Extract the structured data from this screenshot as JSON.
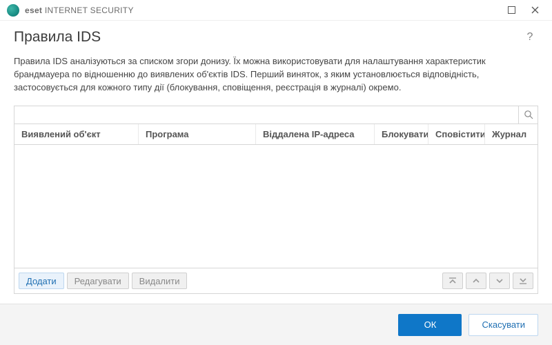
{
  "titlebar": {
    "brand_strong": "eset",
    "brand_rest": " INTERNET SECURITY"
  },
  "header": {
    "title": "Правила IDS",
    "help_tooltip": "?"
  },
  "description": "Правила IDS аналізуються за списком згори донизу. Їх можна використовувати для налаштування характеристик брандмауера по відношенню до виявлених об'єктів IDS. Перший виняток, з яким установлюється відповідність, застосовується для кожного типу дії (блокування, сповіщення, реєстрація в журналі) окремо.",
  "search": {
    "value": ""
  },
  "table": {
    "columns": [
      "Виявлений об'єкт",
      "Програма",
      "Віддалена IP-адреса",
      "Блокувати",
      "Сповістити",
      "Журнал"
    ],
    "rows": []
  },
  "toolbar": {
    "add": "Додати",
    "edit": "Редагувати",
    "delete": "Видалити"
  },
  "footer": {
    "ok": "ОК",
    "cancel": "Скасувати"
  }
}
